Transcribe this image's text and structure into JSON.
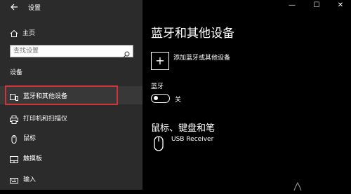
{
  "window": {
    "title": "设置",
    "back_icon": "back-arrow-icon",
    "minimize": "—",
    "maximize": "☐",
    "close": "✕"
  },
  "sidebar": {
    "home_label": "主页",
    "search": {
      "placeholder": "查找设置",
      "value": ""
    },
    "section_title": "设备",
    "items": [
      {
        "label": "蓝牙和其他设备",
        "icon": "bluetooth-devices-icon",
        "active": true
      },
      {
        "label": "打印机和扫描仪",
        "icon": "printer-icon"
      },
      {
        "label": "鼠标",
        "icon": "mouse-icon"
      },
      {
        "label": "触摸板",
        "icon": "touchpad-icon"
      },
      {
        "label": "输入",
        "icon": "keyboard-icon"
      }
    ],
    "highlight_color": "#d0343b"
  },
  "main": {
    "title": "蓝牙和其他设备",
    "add_device": {
      "icon": "+",
      "label": "添加蓝牙或其他设备"
    },
    "bluetooth": {
      "label": "蓝牙",
      "state": "关"
    },
    "section_title": "鼠标、键盘和笔",
    "device": {
      "name": "USB Receiver",
      "icon": "mouse-icon"
    }
  }
}
